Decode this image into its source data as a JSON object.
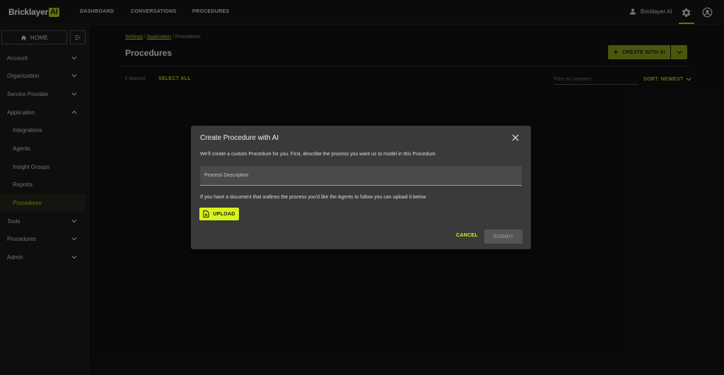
{
  "app": {
    "logo_text": "Bricklayer",
    "logo_badge": "AI"
  },
  "nav": {
    "dashboard": "DASHBOARD",
    "conversations": "CONVERSATIONS",
    "procedures": "PROCEDURES"
  },
  "user": {
    "name": "Bricklayer AI"
  },
  "sidebar": {
    "home_label": "HOME",
    "items": [
      {
        "label": "Account"
      },
      {
        "label": "Organization"
      },
      {
        "label": "Service Provider"
      },
      {
        "label": "Application"
      },
      {
        "label": "Integrations"
      },
      {
        "label": "Agents"
      },
      {
        "label": "Insight Groups"
      },
      {
        "label": "Reports"
      },
      {
        "label": "Procedures"
      },
      {
        "label": "Tools"
      },
      {
        "label": "Procedures"
      },
      {
        "label": "Admin"
      }
    ]
  },
  "breadcrumb": {
    "settings": "Settings",
    "sep": "/",
    "application": "Application",
    "current": "Procedures"
  },
  "page": {
    "title": "Procedures",
    "create_label": "CREATE WITH AI",
    "selected_count": "0 Selected",
    "select_all": "SELECT ALL",
    "filter_placeholder": "Filter by keyword",
    "sort_label": "SORT: NEWEST"
  },
  "modal": {
    "title": "Create Procedure with AI",
    "description": "We'll create a custom Procedure for you. First, describe the process you want us to model in this Procedure.",
    "input_placeholder": "Process Description",
    "upload_note": "If you have a document that outlines the process you'd like the Agents to follow you can upload it below",
    "upload_label": "UPLOAD",
    "cancel_label": "CANCEL",
    "submit_label": "SUBMIT"
  },
  "colors": {
    "accent": "#b5d11a",
    "accent_bright": "#d8f21b",
    "background": "#121212",
    "modal": "#3a3a3a"
  }
}
